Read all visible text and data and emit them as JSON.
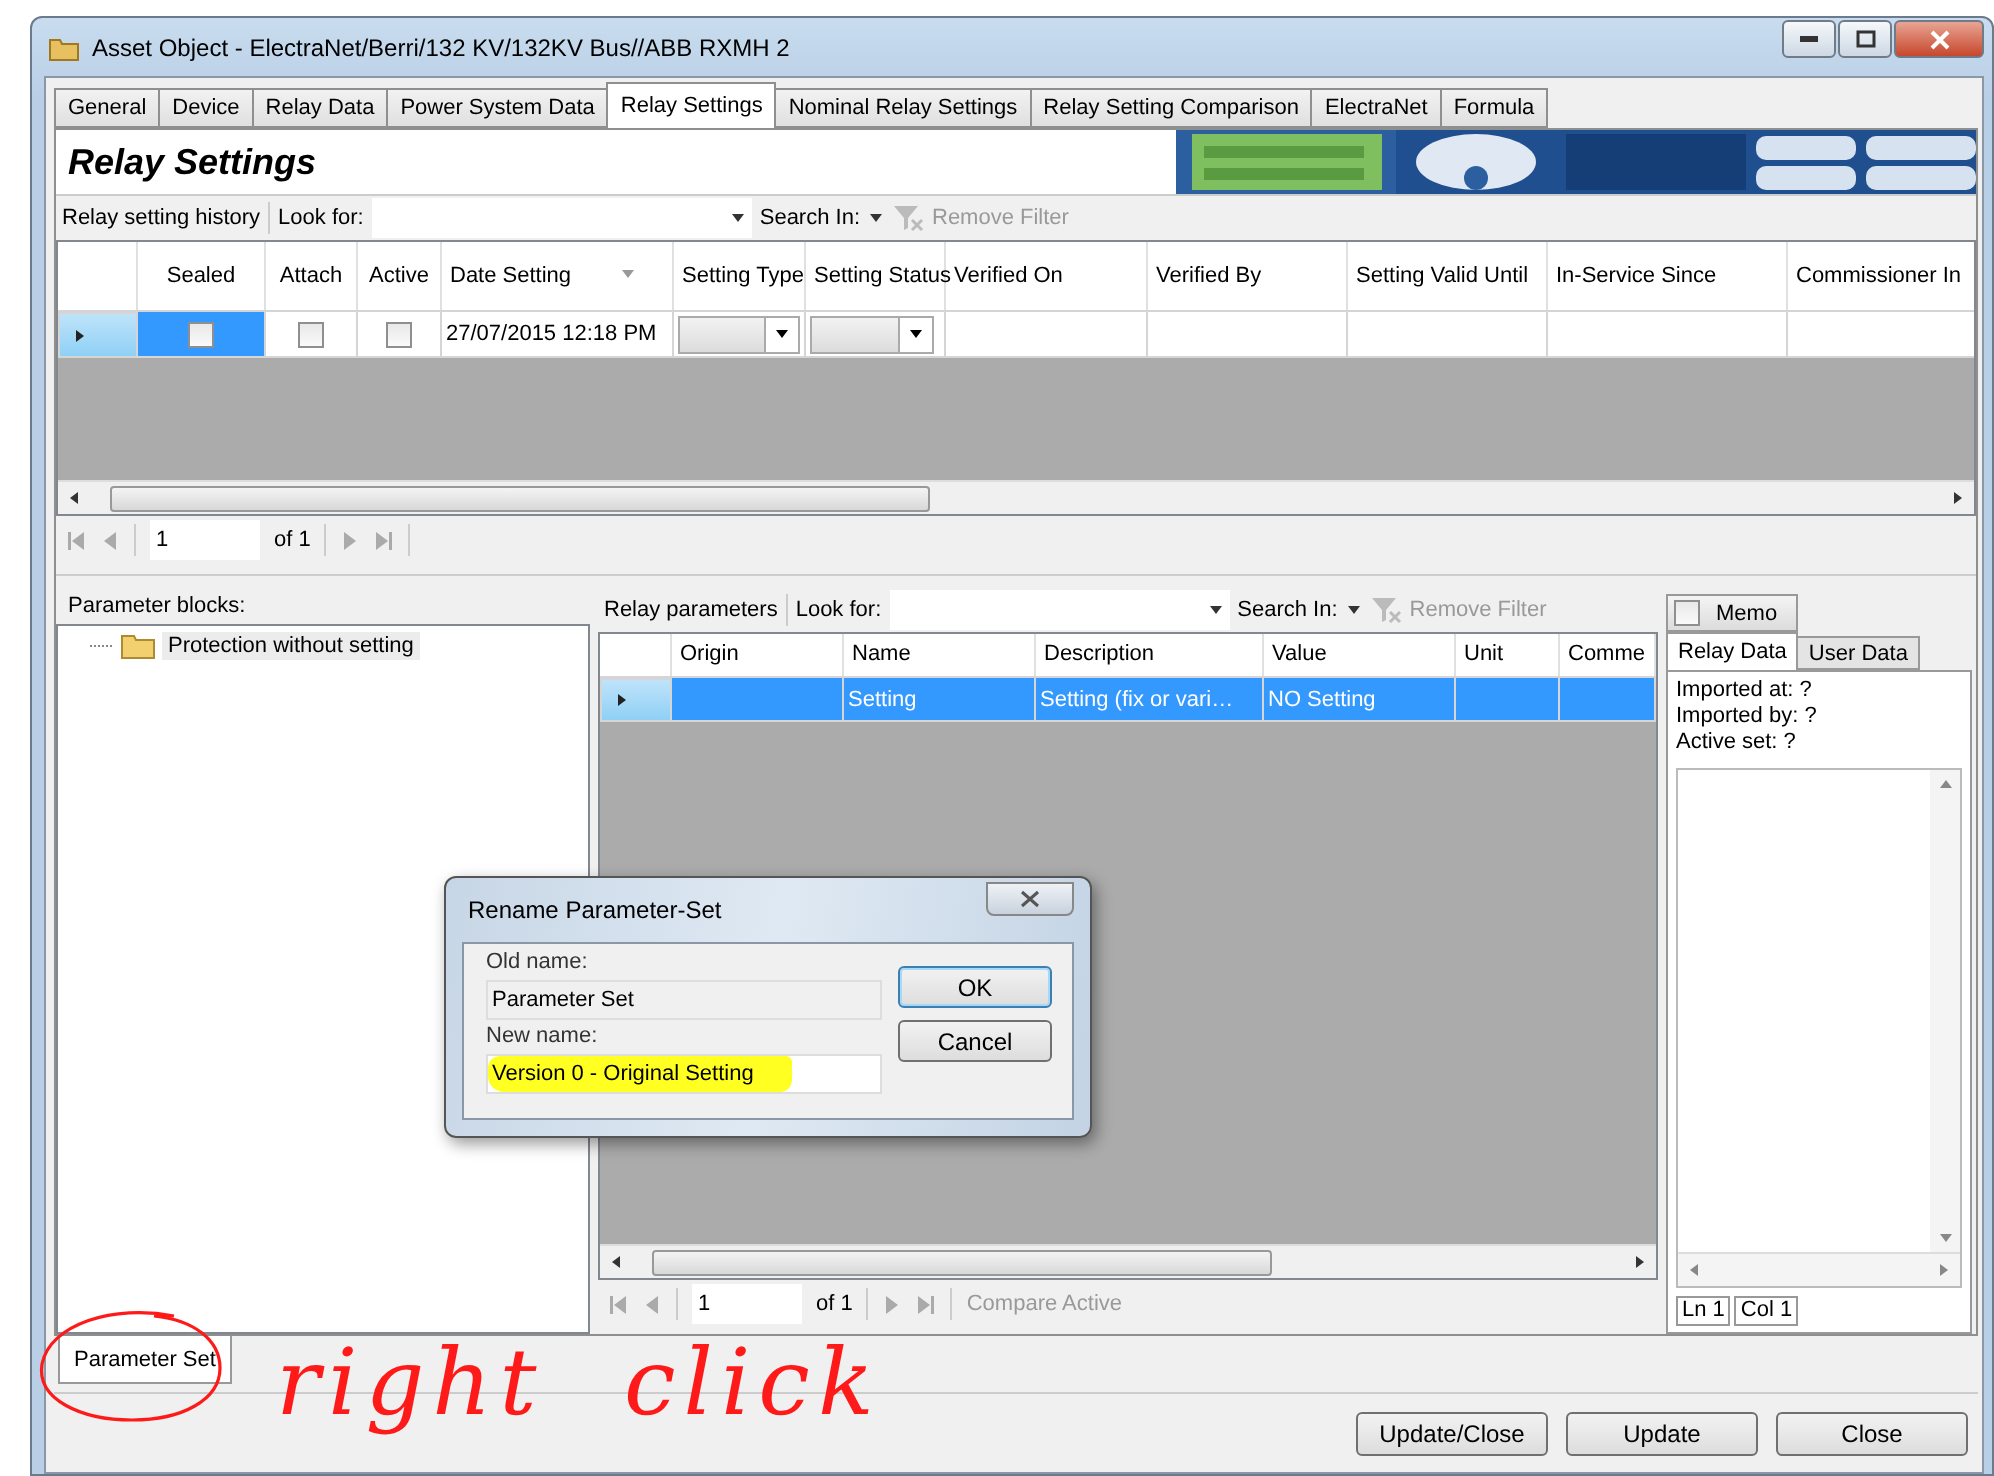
{
  "window": {
    "title": "Asset Object - ElectraNet/Berri/132 KV/132KV Bus//ABB RXMH 2"
  },
  "tabs": [
    {
      "label": "General",
      "selected": false
    },
    {
      "label": "Device",
      "selected": false
    },
    {
      "label": "Relay Data",
      "selected": false
    },
    {
      "label": "Power System Data",
      "selected": false
    },
    {
      "label": "Relay Settings",
      "selected": true
    },
    {
      "label": "Nominal Relay Settings",
      "selected": false
    },
    {
      "label": "Relay Setting Comparison",
      "selected": false
    },
    {
      "label": "ElectraNet",
      "selected": false
    },
    {
      "label": "Formula",
      "selected": false
    }
  ],
  "header": {
    "title": "Relay Settings"
  },
  "history_toolbar": {
    "label": "Relay setting history",
    "look_for": "Look for:",
    "search_in": "Search In:",
    "remove_filter": "Remove Filter"
  },
  "history_table": {
    "columns": [
      {
        "label": "Sealed",
        "kind": "checkbox"
      },
      {
        "label": "Attach",
        "kind": "checkbox"
      },
      {
        "label": "Active",
        "kind": "checkbox"
      },
      {
        "label": "Date Setting",
        "kind": "date"
      },
      {
        "label": "Setting Type",
        "kind": "dropdown"
      },
      {
        "label": "Setting Status",
        "kind": "dropdown"
      },
      {
        "label": "Verified On",
        "kind": "text"
      },
      {
        "label": "Verified By",
        "kind": "text"
      },
      {
        "label": "Setting Valid Until",
        "kind": "text"
      },
      {
        "label": "In-Service Since",
        "kind": "text"
      },
      {
        "label": "Commissioner In",
        "kind": "text"
      }
    ],
    "rows": [
      {
        "selected": true,
        "checks": [
          false,
          false,
          false
        ],
        "date": "27/07/2015 12:18 PM"
      }
    ]
  },
  "history_pager": {
    "page": "1",
    "of": "of 1"
  },
  "parameter_blocks": {
    "label": "Parameter blocks:",
    "tree": [
      {
        "label": "Protection without setting",
        "selected": true
      }
    ]
  },
  "relay_parameters": {
    "label": "Relay parameters",
    "look_for": "Look for:",
    "search_in": "Search In:",
    "remove_filter": "Remove Filter",
    "columns": [
      "Origin",
      "Name",
      "Description",
      "Value",
      "Unit",
      "Comme"
    ],
    "rows": [
      {
        "selected": true,
        "name": "Setting",
        "description": "Setting (fix or vari…",
        "value": "NO Setting"
      }
    ],
    "pager": {
      "page": "1",
      "of": "of 1",
      "compare": "Compare Active"
    }
  },
  "info_panel": {
    "memo": {
      "label": "Memo",
      "checked": false
    },
    "tabs": [
      {
        "label": "Relay Data",
        "selected": true
      },
      {
        "label": "User Data",
        "selected": false
      }
    ],
    "lines": [
      "Imported at: ?",
      "Imported by: ?",
      "Active set: ?"
    ],
    "status": [
      "Ln 1",
      "Col 1"
    ]
  },
  "bottom_tabs": [
    {
      "label": "Parameter Set",
      "selected": true
    }
  ],
  "buttons": [
    "Update/Close",
    "Update",
    "Close"
  ],
  "dialog": {
    "title": "Rename Parameter-Set",
    "old_label": "Old name:",
    "old_value": "Parameter Set",
    "new_label": "New name:",
    "new_value": "Version 0 - Original Setting",
    "buttons": [
      "OK",
      "Cancel"
    ]
  },
  "annotation": {
    "words": [
      "right",
      "click"
    ]
  }
}
